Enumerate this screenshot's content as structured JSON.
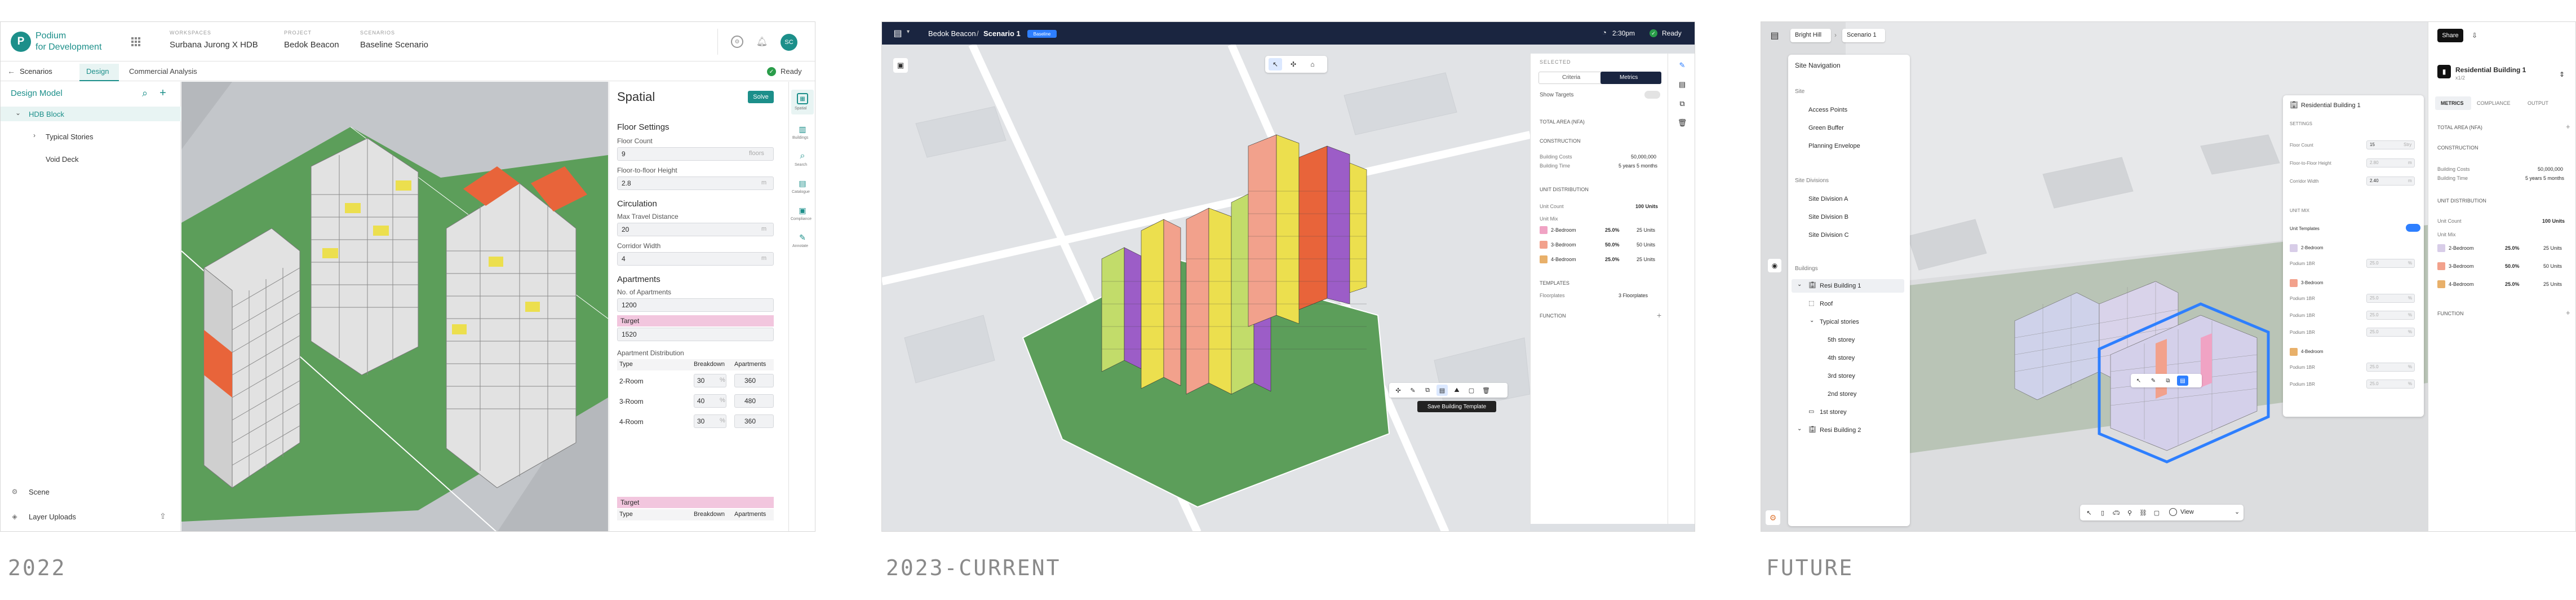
{
  "eras": {
    "a": "2022",
    "b": "2023-CURRENT",
    "c": "FUTURE"
  },
  "colors": {
    "teal": "#1c8f8a",
    "cyan": "#33b6c9",
    "green_site": "#5c9e5a",
    "orange_unit": "#e8643a",
    "yellow_unit": "#ecdf4e",
    "purple_unit": "#9c5dc7",
    "pink_row": "#f0a3c4",
    "lime_unit": "#c2dc6a",
    "salmon_unit": "#f2a18c",
    "blue_select": "#2e7fff",
    "navy_bar": "#1a2540",
    "highlight_pink": "#f2c6de"
  },
  "p1": {
    "logo": {
      "line1": "Podium",
      "line2": "for Development"
    },
    "crumbs": [
      {
        "label": "WORKSPACES",
        "value": "Surbana Jurong X HDB"
      },
      {
        "label": "PROJECT",
        "value": "Bedok Beacon"
      },
      {
        "label": "SCENARIOS",
        "value": "Baseline Scenario"
      }
    ],
    "avatar": "SC",
    "back": "Scenarios",
    "tabs": [
      "Design",
      "Commercial Analysis"
    ],
    "status": "Ready",
    "left": {
      "title": "Design Model",
      "block": "HDB Block",
      "children": [
        "Typical Stories",
        "Void Deck"
      ],
      "footer": [
        "Scene",
        "Layer Uploads"
      ]
    },
    "spatial": {
      "title": "Spatial",
      "solve": "Solve",
      "floor_settings": "Floor Settings",
      "floor_count": {
        "label": "Floor Count",
        "value": "9",
        "unit": "floors"
      },
      "ftf": {
        "label": "Floor-to-floor Height",
        "value": "2.8",
        "unit": "m"
      },
      "circulation": "Circulation",
      "mtd": {
        "label": "Max Travel Distance",
        "value": "20",
        "unit": "m"
      },
      "corridor": {
        "label": "Corridor Width",
        "value": "4",
        "unit": "m"
      },
      "apartments": "Apartments",
      "apt_count": {
        "label": "No. of Apartments",
        "value": "1200"
      },
      "target": {
        "label": "Target",
        "value": "1520"
      },
      "dist_title": "Apartment Distribution",
      "dist_head": [
        "Type",
        "Breakdown",
        "Apartments"
      ],
      "dist_rows": [
        {
          "type": "2-Room",
          "pct": "30",
          "unit": "%",
          "apts": "360"
        },
        {
          "type": "3-Room",
          "pct": "40",
          "unit": "%",
          "apts": "480"
        },
        {
          "type": "4-Room",
          "pct": "30",
          "unit": "%",
          "apts": "360"
        }
      ],
      "target2": "Target",
      "dist_head2": [
        "Type",
        "Breakdown",
        "Apartments"
      ]
    },
    "rail": [
      "Spatial",
      "Buildings",
      "Search",
      "Catalogue",
      "Compliance",
      "Annotate"
    ]
  },
  "p2": {
    "crumb": {
      "project": "Bedok Beacon",
      "sep": "/",
      "scenario": "Scenario 1",
      "badge": "Baseline"
    },
    "time": "2:30pm",
    "status": "Ready",
    "panel": {
      "selected": "SELECTED",
      "criteria": "Criteria",
      "metrics": "Metrics",
      "show_targets": "Show Targets",
      "sections": [
        "TOTAL AREA (NFA)",
        "CONSTRUCTION",
        "UNIT DISTRIBUTION",
        "TEMPLATES",
        "FUNCTION"
      ],
      "construction": [
        {
          "k": "Building Costs",
          "v": "50,000,000"
        },
        {
          "k": "Building Time",
          "v": "5 years 5 months"
        }
      ],
      "unit_count": {
        "k": "Unit Count",
        "v": "100 Units"
      },
      "unit_mix": "Unit Mix",
      "mix": [
        {
          "t": "2-Bedroom",
          "p": "25.0%",
          "u": "25 Units"
        },
        {
          "t": "3-Bedroom",
          "p": "50.0%",
          "u": "50 Units"
        },
        {
          "t": "4-Bedroom",
          "p": "25.0%",
          "u": "25 Units"
        }
      ],
      "floorplates": {
        "k": "Floorplates",
        "v": "3 Floorplates"
      }
    },
    "tooltip": "Save Building Template"
  },
  "p3": {
    "crumbs": [
      "Bright Hill",
      "Scenario 1"
    ],
    "share": "Share",
    "nav": {
      "title": "Site Navigation",
      "site": "Site",
      "site_items": [
        "Access Points",
        "Green Buffer",
        "Planning Envelope"
      ],
      "divisions": "Site Divisions",
      "div_items": [
        "Site Division A",
        "Site Division B",
        "Site Division C"
      ],
      "buildings": "Buildings",
      "b1": "Resi Building 1",
      "roof": "Roof",
      "typ": "Typical stories",
      "stories": [
        "5th storey",
        "4th storey",
        "3rd storey",
        "2nd storey"
      ],
      "first": "1st storey",
      "b2": "Resi Building 2"
    },
    "float": {
      "title": "Residential Building 1",
      "settings": "SETTINGS",
      "rows": [
        {
          "k": "Floor Count",
          "v": "15",
          "u": "Stry"
        },
        {
          "k": "Floor-to-Floor Height",
          "v": "2.80",
          "u": "m"
        },
        {
          "k": "Corridor Width",
          "v": "2.40",
          "u": "m"
        }
      ],
      "unit_mix": "UNIT MIX",
      "templates": "Unit Templates",
      "tpl": [
        {
          "n": "2-Bedroom",
          "r": [
            {
              "k": "Podium 1BR",
              "v": "25.0"
            }
          ]
        },
        {
          "n": "3-Bedroom",
          "r": [
            {
              "k": "Podium 1BR",
              "v": "25.0"
            },
            {
              "k": "Podium 1BR",
              "v": "25.0"
            },
            {
              "k": "Podium 1BR",
              "v": "25.0"
            }
          ]
        },
        {
          "n": "4-Bedroom",
          "r": [
            {
              "k": "Podium 1BR",
              "v": "25.0"
            },
            {
              "k": "Podium 1BR",
              "v": "25.0"
            }
          ]
        }
      ],
      "pct": "%"
    },
    "right": {
      "title": "Residential Building 1",
      "sub": "x1/2",
      "tabs": [
        "METRICS",
        "COMPLIANCE",
        "OUTPUT"
      ],
      "sections": [
        "TOTAL AREA (NFA)",
        "CONSTRUCTION",
        "UNIT DISTRIBUTION",
        "FUNCTION"
      ],
      "construction": [
        {
          "k": "Building Costs",
          "v": "50,000,000"
        },
        {
          "k": "Building Time",
          "v": "5 years 5 months"
        }
      ],
      "unit_count": {
        "k": "Unit Count",
        "v": "100 Units"
      },
      "unit_mix": "Unit Mix",
      "mix": [
        {
          "t": "2-Bedroom",
          "p": "25.0%",
          "u": "25 Units"
        },
        {
          "t": "3-Bedroom",
          "p": "50.0%",
          "u": "50 Units"
        },
        {
          "t": "4-Bedroom",
          "p": "25.0%",
          "u": "25 Units"
        }
      ]
    },
    "view": "View"
  }
}
